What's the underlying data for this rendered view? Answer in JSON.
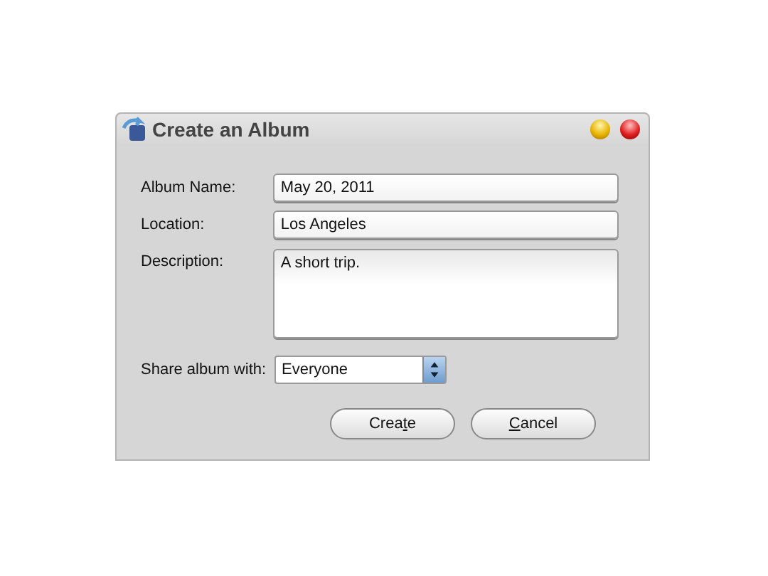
{
  "window": {
    "title": "Create an Album"
  },
  "fields": [
    {
      "label": "Album Name:",
      "kind": "text",
      "value": "May 20, 2011"
    },
    {
      "label": "Location:",
      "kind": "text",
      "value": "Los Angeles"
    },
    {
      "label": "Description:",
      "kind": "textarea",
      "value": "A short trip."
    },
    {
      "label": "Share album with:",
      "kind": "select",
      "value": "Everyone"
    }
  ],
  "buttons": [
    {
      "before": "Crea",
      "mnemonic": "t",
      "after": "e"
    },
    {
      "mnemonic": "C",
      "after": "ancel"
    }
  ]
}
